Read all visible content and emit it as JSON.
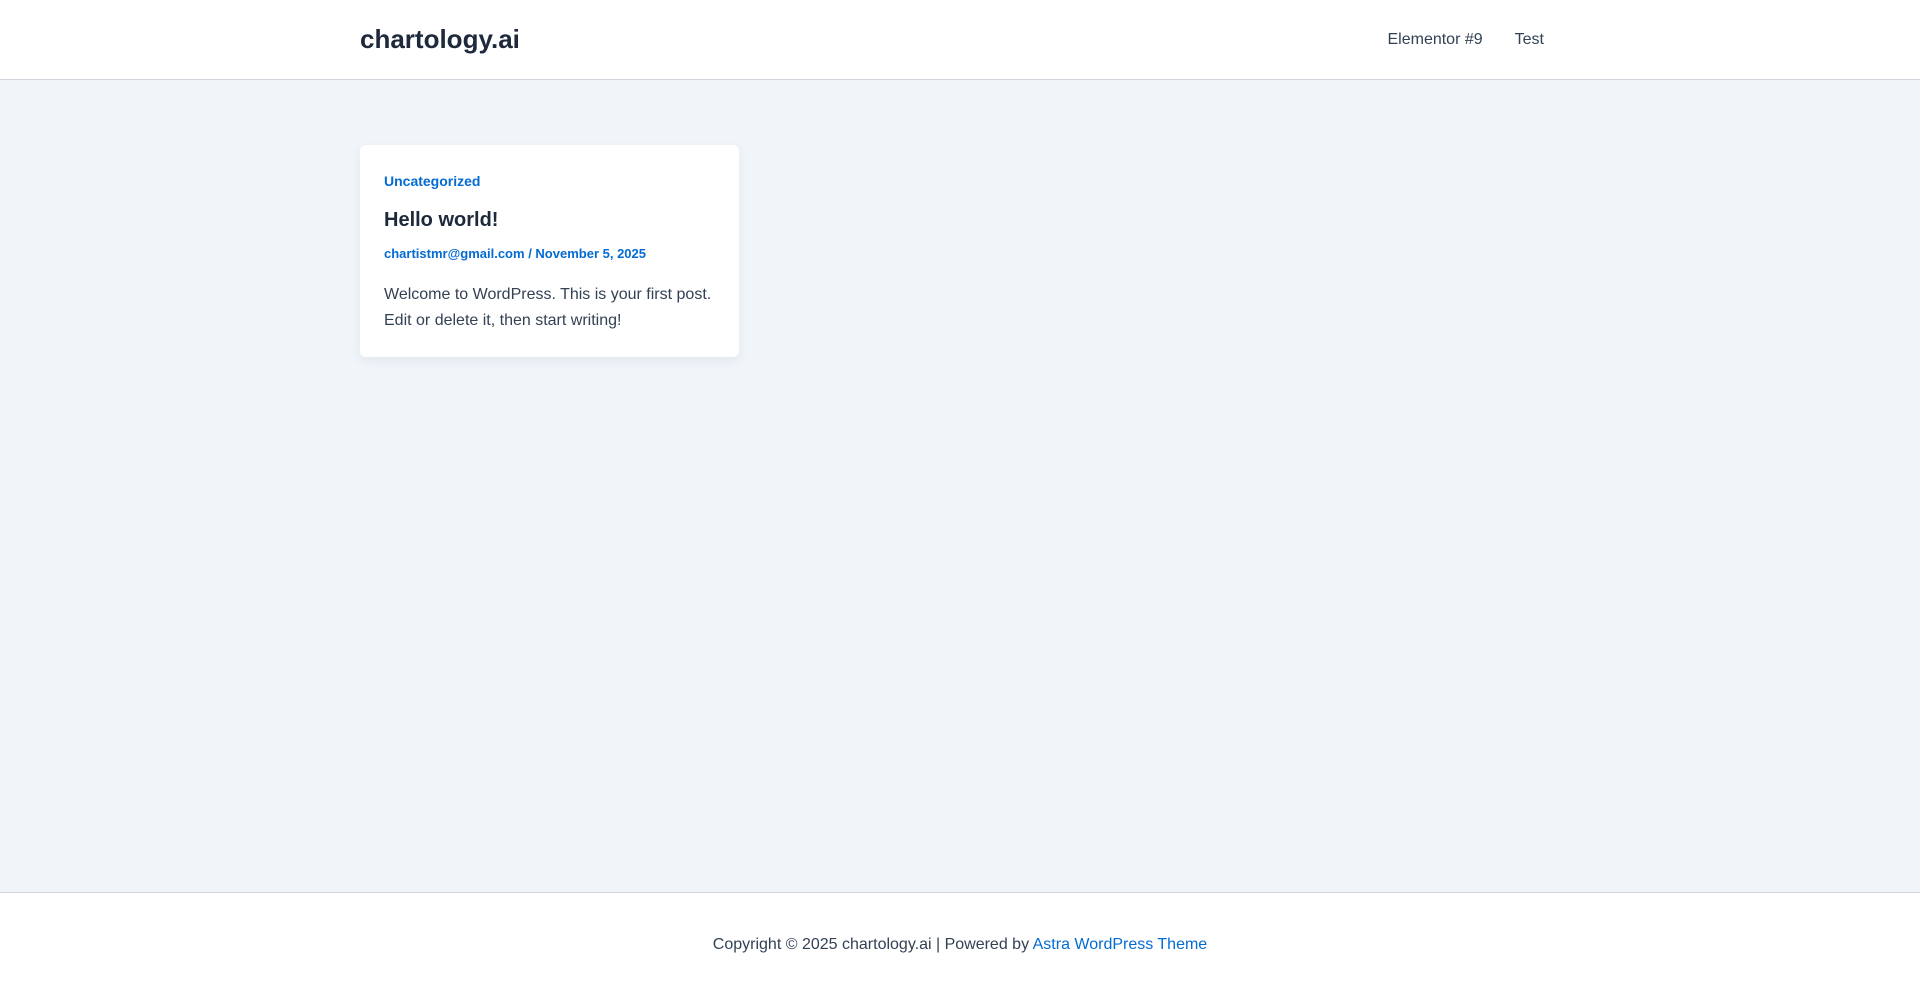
{
  "header": {
    "site_title": "chartology.ai",
    "nav": [
      {
        "label": "Elementor #9"
      },
      {
        "label": "Test"
      }
    ]
  },
  "post": {
    "category": "Uncategorized",
    "title": "Hello world!",
    "author": "chartistmr@gmail.com",
    "separator": "/",
    "date": "November 5, 2025",
    "excerpt": "Welcome to WordPress. This is your first post. Edit or delete it, then start writing!"
  },
  "footer": {
    "copyright": "Copyright © 2025 chartology.ai | Powered by",
    "theme_link": "Astra WordPress Theme"
  },
  "colors": {
    "accent": "#046bd2",
    "heading": "#1e293b",
    "text": "#334155",
    "background": "#f0f5fa"
  }
}
